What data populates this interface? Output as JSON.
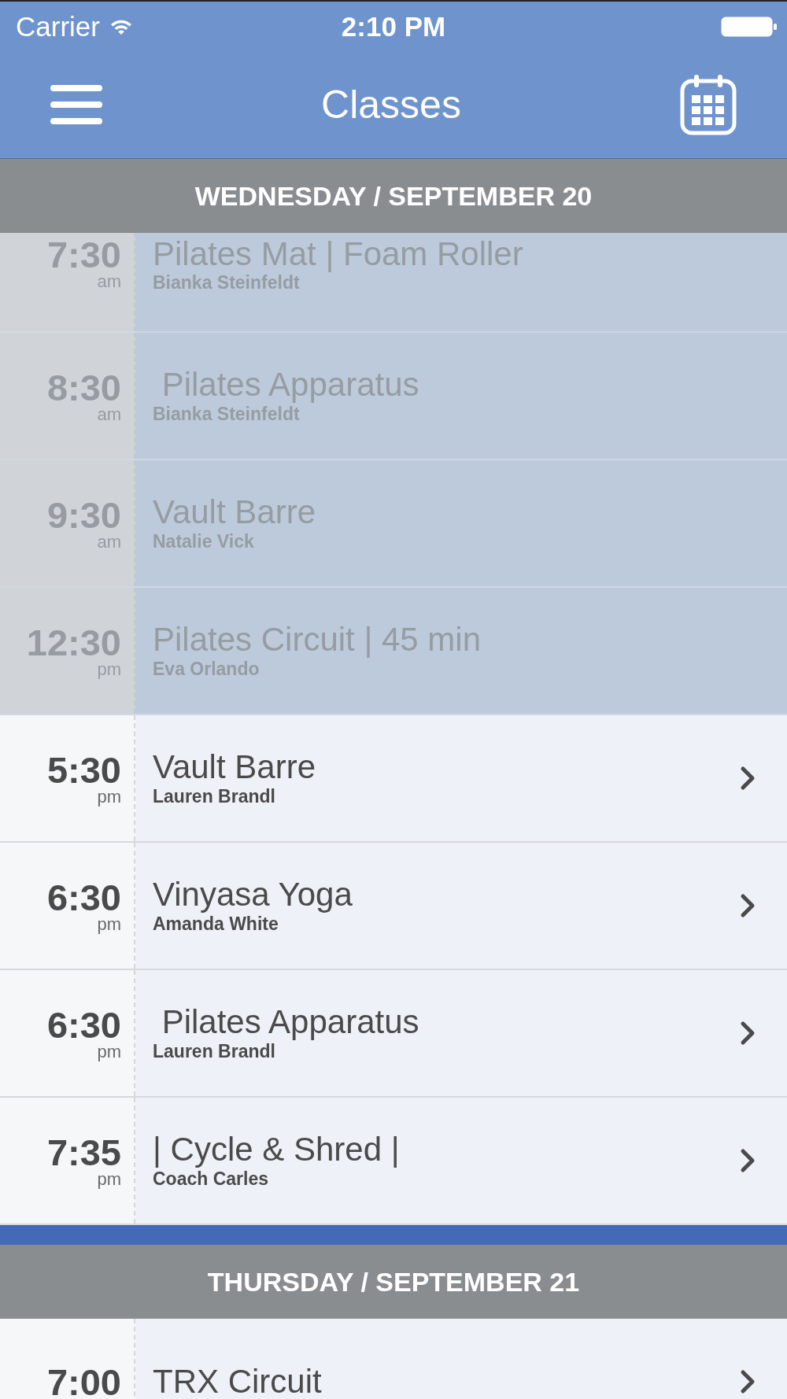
{
  "status_bar": {
    "carrier": "Carrier",
    "time": "2:10 PM"
  },
  "nav_bar": {
    "title": "Classes"
  },
  "days": [
    {
      "label": "WEDNESDAY / SEPTEMBER 20",
      "classes": [
        {
          "time": "7:30",
          "meridiem": "am",
          "title": "Pilates Mat | Foam Roller",
          "instructor": "Bianka Steinfeldt",
          "past": true
        },
        {
          "time": "8:30",
          "meridiem": "am",
          "title": " Pilates Apparatus",
          "instructor": "Bianka Steinfeldt",
          "past": true
        },
        {
          "time": "9:30",
          "meridiem": "am",
          "title": "Vault Barre",
          "instructor": "Natalie Vick",
          "past": true
        },
        {
          "time": "12:30",
          "meridiem": "pm",
          "title": "Pilates Circuit | 45 min",
          "instructor": "Eva Orlando",
          "past": true
        },
        {
          "time": "5:30",
          "meridiem": "pm",
          "title": "Vault Barre",
          "instructor": "Lauren Brandl",
          "past": false
        },
        {
          "time": "6:30",
          "meridiem": "pm",
          "title": "Vinyasa Yoga",
          "instructor": "Amanda White",
          "past": false
        },
        {
          "time": "6:30",
          "meridiem": "pm",
          "title": " Pilates Apparatus",
          "instructor": "Lauren Brandl",
          "past": false
        },
        {
          "time": "7:35",
          "meridiem": "pm",
          "title": "| Cycle & Shred |",
          "instructor": "Coach Carles",
          "past": false
        }
      ]
    },
    {
      "label": "THURSDAY / SEPTEMBER 21",
      "classes": [
        {
          "time": "7:00",
          "title": "TRX Circuit",
          "past": false
        }
      ]
    }
  ]
}
